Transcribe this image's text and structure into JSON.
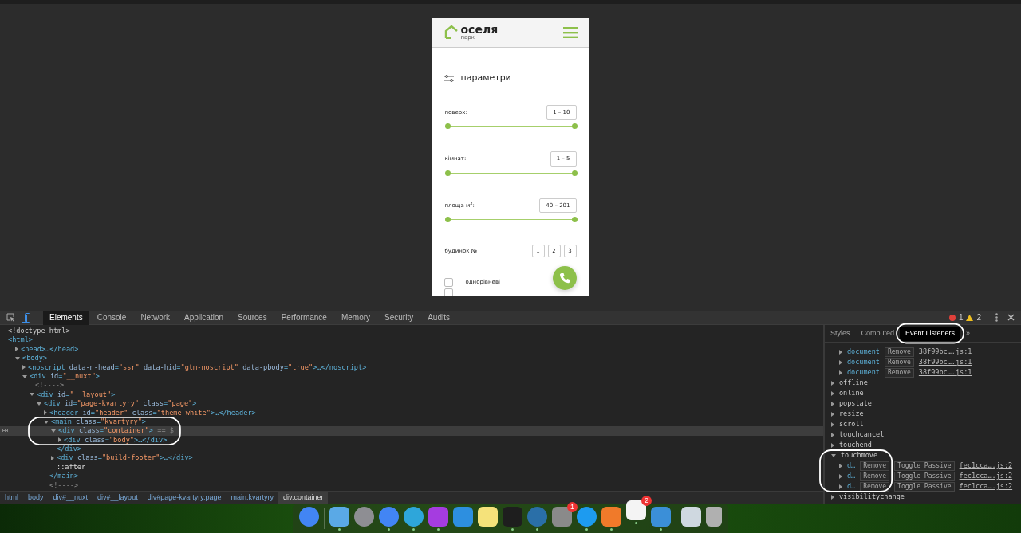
{
  "mobile_page": {
    "logo": {
      "name": "оселя",
      "subtitle": "парк"
    },
    "filters_title": "параметри",
    "ranges": [
      {
        "label": "поверх:",
        "value": "1 – 10",
        "level": 1
      },
      {
        "label": "кімнат:",
        "value": "1 – 5",
        "level": 1
      },
      {
        "label": "площа м$^{2}$:",
        "value": "40 – 201",
        "level": 1
      }
    ],
    "building": {
      "label": "будинок №",
      "options": [
        {
          "label": "1",
          "selected": false
        },
        {
          "label": "2",
          "selected": false
        },
        {
          "label": "3",
          "selected": false
        }
      ]
    },
    "checkboxes": [
      {
        "label": "однорівневі",
        "checked": false
      },
      {
        "checked": false
      }
    ]
  },
  "devtools": {
    "tabs": [
      {
        "label": "Elements",
        "selected": true
      },
      {
        "label": "Console",
        "selected": false
      },
      {
        "label": "Network",
        "selected": false
      },
      {
        "label": "Application",
        "selected": false
      },
      {
        "label": "Sources",
        "selected": false
      },
      {
        "label": "Performance",
        "selected": false
      },
      {
        "label": "Memory",
        "selected": false
      },
      {
        "label": "Security",
        "selected": false
      },
      {
        "label": "Audits",
        "selected": false
      }
    ],
    "errors": "1",
    "warnings": "2",
    "dom_tree": [
      {
        "kind": "text",
        "text": "<!doctype html>"
      },
      {
        "kind": "tag",
        "text": "<html>",
        "children": [
          {
            "kind": "tag",
            "text": "<head>…</head>",
            "expanded": false
          },
          {
            "kind": "tag",
            "text": "<body>",
            "expanded": true,
            "children": [
              {
                "kind": "tag",
                "text": "<noscript data-n-head=\"ssr\" data-hid=\"gtm-noscript\" data-pbody=\"true\">…</noscript>",
                "expanded": false
              },
              {
                "kind": "tag",
                "text": "<div id=\"__nuxt\">",
                "expanded": true,
                "children": [
                  {
                    "kind": "comment",
                    "text": "<!---->"
                  },
                  {
                    "kind": "tag",
                    "text": "<div id=\"__layout\">",
                    "expanded": true,
                    "children": [
                      {
                        "kind": "tag",
                        "text": "<div id=\"page-kvartyry\" class=\"page\">",
                        "expanded": true,
                        "children": [
                          {
                            "kind": "tag",
                            "text": "<header id=\"header\" class=\"theme-white\">…</header>",
                            "expanded": false
                          },
                          {
                            "kind": "tag",
                            "text": "<main class=\"kvartyry\">",
                            "expanded": true,
                            "children": [
                              {
                                "kind": "tag",
                                "text": "<div class=\"container\">",
                                "suffix": "== $",
                                "expanded": true,
                                "selected": true,
                                "children": [
                                  {
                                    "kind": "tag",
                                    "text": "<div class=\"body\">…</div>",
                                    "expanded": false
                                  }
                                ]
                              },
                              {
                                "kind": "tag",
                                "text": "</div>"
                              },
                              {
                                "kind": "tag",
                                "text": "<div class=\"build-footer\">…</div>",
                                "expanded": false
                              },
                              {
                                "kind": "pseudo",
                                "text": "::after"
                              }
                            ]
                          },
                          {
                            "kind": "tag",
                            "text": "</main>"
                          },
                          {
                            "kind": "comment",
                            "text": "<!---->"
                          }
                        ]
                      }
                    ]
                  }
                ]
              }
            ]
          }
        ]
      }
    ],
    "breadcrumbs": [
      {
        "label": "html",
        "selected": false
      },
      {
        "label": "body",
        "selected": false
      },
      {
        "label": "div#__nuxt",
        "selected": false
      },
      {
        "label": "div#__layout",
        "selected": false
      },
      {
        "label": "div#page-kvartyry.page",
        "selected": false
      },
      {
        "label": "main.kvartyry",
        "selected": false
      },
      {
        "label": "div.container",
        "selected": true
      }
    ],
    "side_tabs": [
      {
        "label": "Styles",
        "selected": false
      },
      {
        "label": "Computed",
        "selected": false
      },
      {
        "label": "Event Listeners",
        "selected": true
      }
    ],
    "more_tabs": "»",
    "listeners": [
      {
        "kind": "listener",
        "node": "document",
        "remove": "Remove",
        "source": "38f99bc….js:1"
      },
      {
        "kind": "listener",
        "node": "document",
        "remove": "Remove",
        "source": "38f99bc….js:1"
      },
      {
        "kind": "listener",
        "node": "document",
        "remove": "Remove",
        "source": "38f99bc….js:1"
      },
      {
        "kind": "event",
        "name": "offline",
        "expanded": false
      },
      {
        "kind": "event",
        "name": "online",
        "expanded": false
      },
      {
        "kind": "event",
        "name": "popstate",
        "expanded": false
      },
      {
        "kind": "event",
        "name": "resize",
        "expanded": false
      },
      {
        "kind": "event",
        "name": "scroll",
        "expanded": false
      },
      {
        "kind": "event",
        "name": "touchcancel",
        "expanded": false
      },
      {
        "kind": "event",
        "name": "touchend",
        "expanded": false
      },
      {
        "kind": "event",
        "name": "touchmove",
        "expanded": true,
        "children": [
          {
            "node": "d…",
            "remove": "Remove",
            "passive": "Toggle Passive",
            "source": "fec1cca….js:2"
          },
          {
            "node": "d…",
            "remove": "Remove",
            "passive": "Toggle Passive",
            "source": "fec1cca….js:2"
          },
          {
            "node": "d…",
            "remove": "Remove",
            "passive": "Toggle Passive",
            "source": "fec1cca….js:2"
          }
        ]
      },
      {
        "kind": "event",
        "name": "visibilitychange",
        "expanded": false
      }
    ]
  },
  "dock": [
    {
      "kind": "round",
      "color": "#4285f4",
      "running": false
    },
    {
      "kind": "divider"
    },
    {
      "kind": "square",
      "color": "#5aa9e6",
      "running": true
    },
    {
      "kind": "round",
      "color": "#8e8e93",
      "running": false
    },
    {
      "kind": "round",
      "color": "#4285f4",
      "running": true
    },
    {
      "kind": "round",
      "color": "#2ea6da",
      "running": true
    },
    {
      "kind": "square",
      "color": "#a53ce0",
      "running": true
    },
    {
      "kind": "square",
      "color": "#2d8fe0",
      "running": false
    },
    {
      "kind": "square",
      "color": "#f5e27a",
      "running": false
    },
    {
      "kind": "square",
      "color": "#1e1e1e",
      "running": true
    },
    {
      "kind": "round",
      "color": "#2a6fa8",
      "running": true
    },
    {
      "kind": "square",
      "color": "#8a8a8a",
      "running": false,
      "badge": "1"
    },
    {
      "kind": "round",
      "color": "#1d9bf0",
      "running": true
    },
    {
      "kind": "square",
      "color": "#f07a2a",
      "running": true
    },
    {
      "kind": "square",
      "color": "#f4f4f4",
      "running": true,
      "badge": "2",
      "bouncing": true
    },
    {
      "kind": "square",
      "color": "#3b8fd8",
      "running": true
    },
    {
      "kind": "divider"
    },
    {
      "kind": "square",
      "color": "#cfd8e0",
      "running": false
    },
    {
      "kind": "trash",
      "color": "#b0b0b0",
      "running": false
    }
  ]
}
